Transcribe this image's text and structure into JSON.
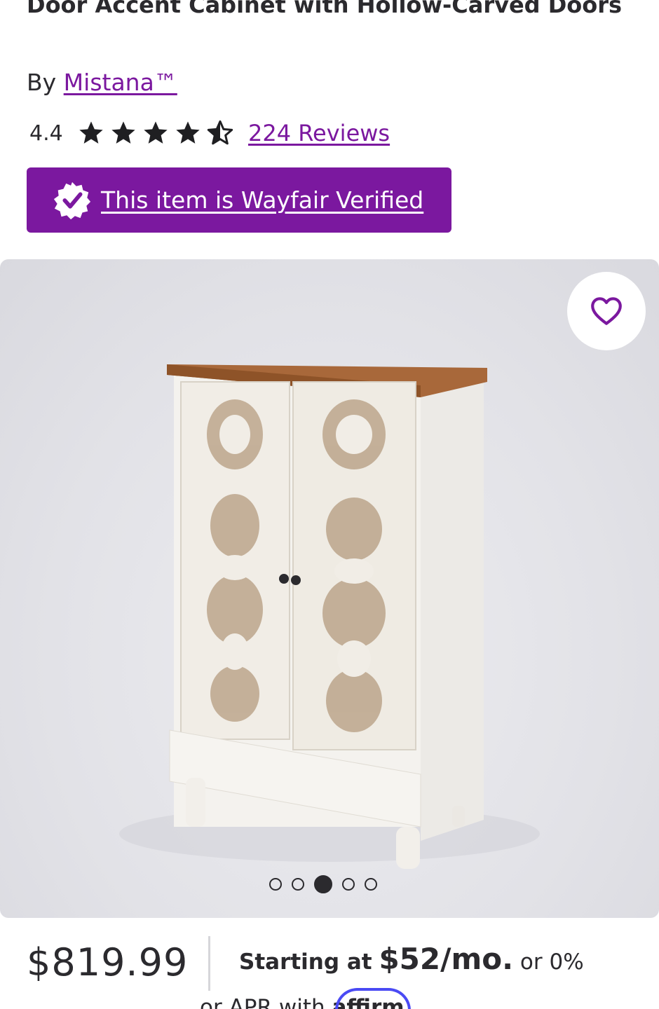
{
  "product": {
    "title": "Door Accent Cabinet with Hollow-Carved Doors",
    "by_prefix": "By",
    "brand": "Mistana™",
    "rating": "4.4",
    "stars_filled": 4.4,
    "reviews": "224 Reviews",
    "verified": "This item is Wayfair Verified"
  },
  "gallery": {
    "favorite_icon": "heart-outline-icon",
    "dots_total": 5,
    "active_index": 2
  },
  "pricing": {
    "price": "$819.99",
    "starting_prefix": "Starting at",
    "monthly": "$52/mo.",
    "monthly_suffix": "or 0%",
    "line2": "or   APR with",
    "affirm": "affirm"
  },
  "colors": {
    "brand_purple": "#7b189f",
    "text": "#2b2a2e",
    "affirm_blue": "#4a4af4"
  }
}
